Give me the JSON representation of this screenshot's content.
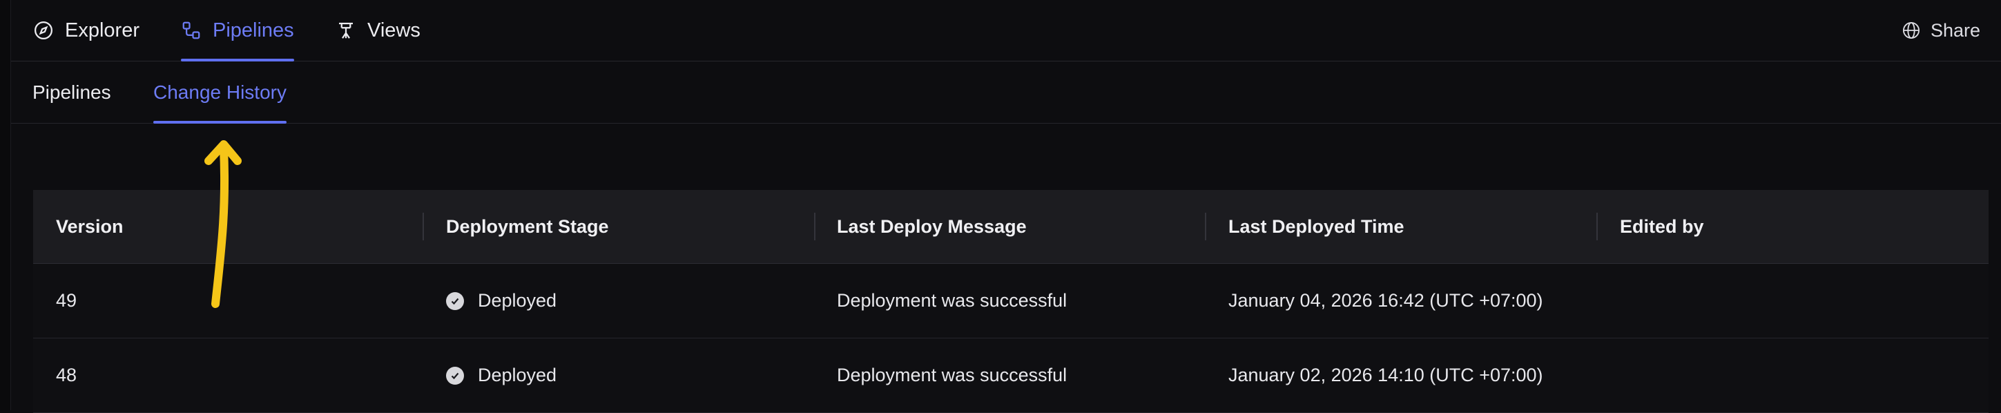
{
  "top_nav": {
    "tabs": [
      {
        "label": "Explorer",
        "icon": "compass-icon"
      },
      {
        "label": "Pipelines",
        "icon": "pipeline-icon",
        "active": true
      },
      {
        "label": "Views",
        "icon": "views-icon"
      }
    ],
    "share_label": "Share",
    "accent_color": "#6d7cf5"
  },
  "sub_nav": {
    "tabs": [
      {
        "label": "Pipelines"
      },
      {
        "label": "Change History",
        "active": true
      }
    ]
  },
  "table": {
    "headers": [
      "Version",
      "Deployment Stage",
      "Last Deploy Message",
      "Last Deployed Time",
      "Edited by"
    ],
    "rows": [
      {
        "version": "49",
        "stage": "Deployed",
        "message": "Deployment was successful",
        "time": "January 04, 2026 16:42 (UTC +07:00)",
        "edited_by": ""
      },
      {
        "version": "48",
        "stage": "Deployed",
        "message": "Deployment was successful",
        "time": "January 02, 2026 14:10 (UTC +07:00)",
        "edited_by": ""
      }
    ]
  },
  "annotation": {
    "color": "#f5c518",
    "icon": "arrow-up-annotation"
  }
}
